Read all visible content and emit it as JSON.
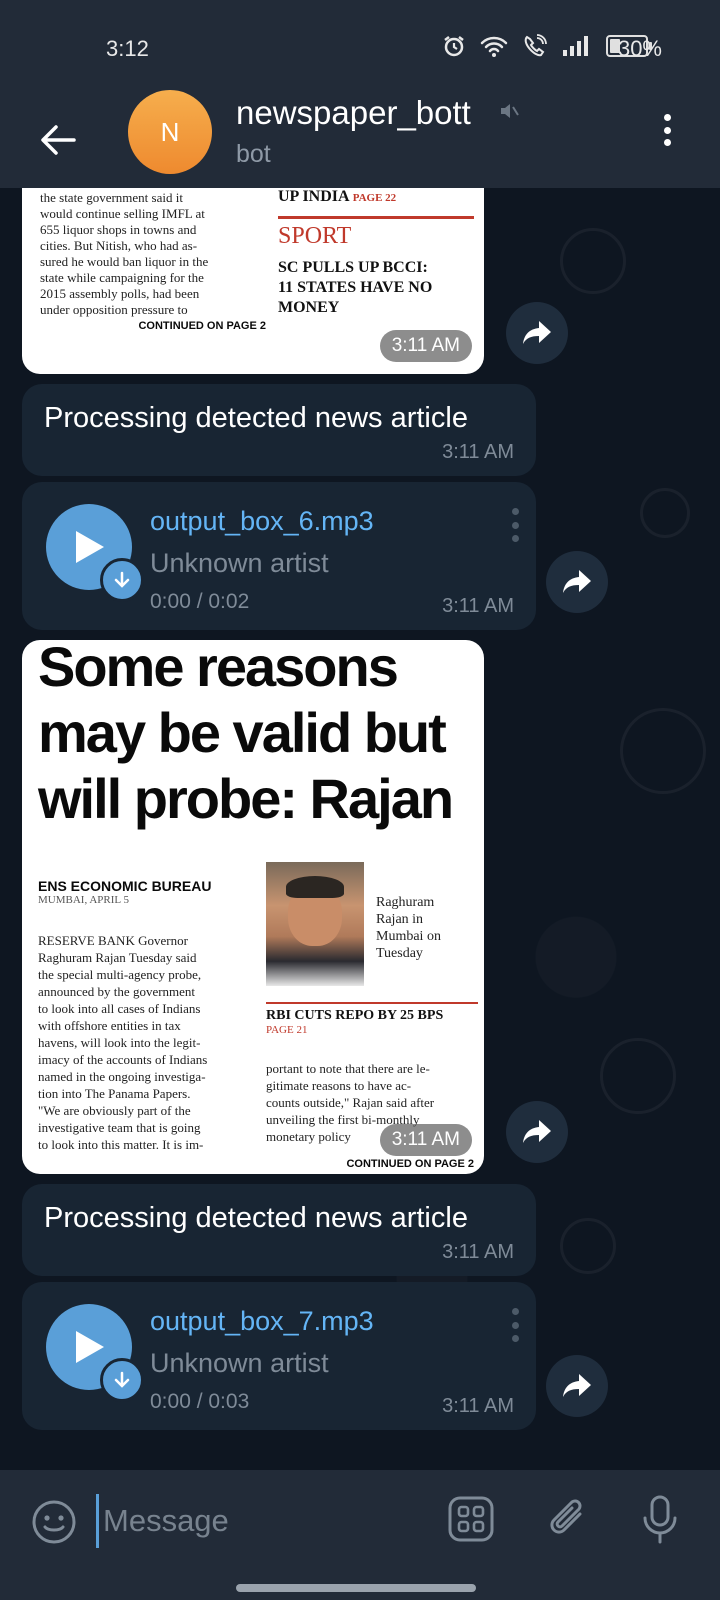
{
  "status_bar": {
    "time": "3:12",
    "battery": "30%"
  },
  "header": {
    "title": "newspaper_bott",
    "subtitle": "bot",
    "avatar_letter": "N",
    "avatar_color": "#f0952f"
  },
  "messages": [
    {
      "type": "image",
      "time": "3:11 AM",
      "newspaper": {
        "col1": [
          "the state government said it",
          "would continue selling IMFL at",
          "655 liquor shops in towns and",
          "cities. But Nitish, who had as-",
          "sured he would ban liquor in the",
          "state while campaigning for the",
          "2015 assembly polls, had been",
          "under opposition pressure to"
        ],
        "continued": "CONTINUED ON PAGE 2",
        "right_top": "UP INDIA",
        "right_top_page": "PAGE 22",
        "section": "SPORT",
        "sport_head": [
          "SC PULLS UP BCCI:",
          "11 STATES HAVE NO",
          "MONEY"
        ]
      }
    },
    {
      "type": "text",
      "text": "Processing detected news article",
      "time": "3:11 AM"
    },
    {
      "type": "audio",
      "file": "output_box_6.mp3",
      "artist": "Unknown artist",
      "duration": "0:00 / 0:02",
      "time": "3:11 AM"
    },
    {
      "type": "image",
      "time": "3:11 AM",
      "newspaper": {
        "headline": [
          "Some reasons",
          "may be valid but",
          "will probe: Rajan"
        ],
        "byline": "ENS ECONOMIC BUREAU",
        "dateline": "MUMBAI, APRIL 5",
        "body": [
          "RESERVE BANK Governor",
          "Raghuram Rajan Tuesday said",
          "the special multi-agency probe,",
          "announced by the government",
          "to look into all cases of Indians",
          "with offshore entities in tax",
          "havens, will look into the legit-",
          "imacy of the accounts of Indians",
          "named in the ongoing investiga-",
          "tion into The Panama Papers.",
          "\"We are obviously part of the",
          "investigative team that is going",
          "to look into this matter. It is im-"
        ],
        "caption": [
          "Raghuram",
          "Rajan in",
          "Mumbai on",
          "Tuesday"
        ],
        "side_head": "RBI CUTS REPO BY 25 BPS",
        "side_page": "PAGE 21",
        "side_body": [
          "portant to note that there are le-",
          "gitimate reasons to have ac-",
          "counts outside,\" Rajan said after",
          "unveiling the first bi-monthly",
          "monetary policy"
        ],
        "continued": "CONTINUED ON PAGE 2"
      }
    },
    {
      "type": "text",
      "text": "Processing detected news article",
      "time": "3:11 AM"
    },
    {
      "type": "audio",
      "file": "output_box_7.mp3",
      "artist": "Unknown artist",
      "duration": "0:00 / 0:03",
      "time": "3:11 AM"
    }
  ],
  "input": {
    "placeholder": "Message"
  }
}
